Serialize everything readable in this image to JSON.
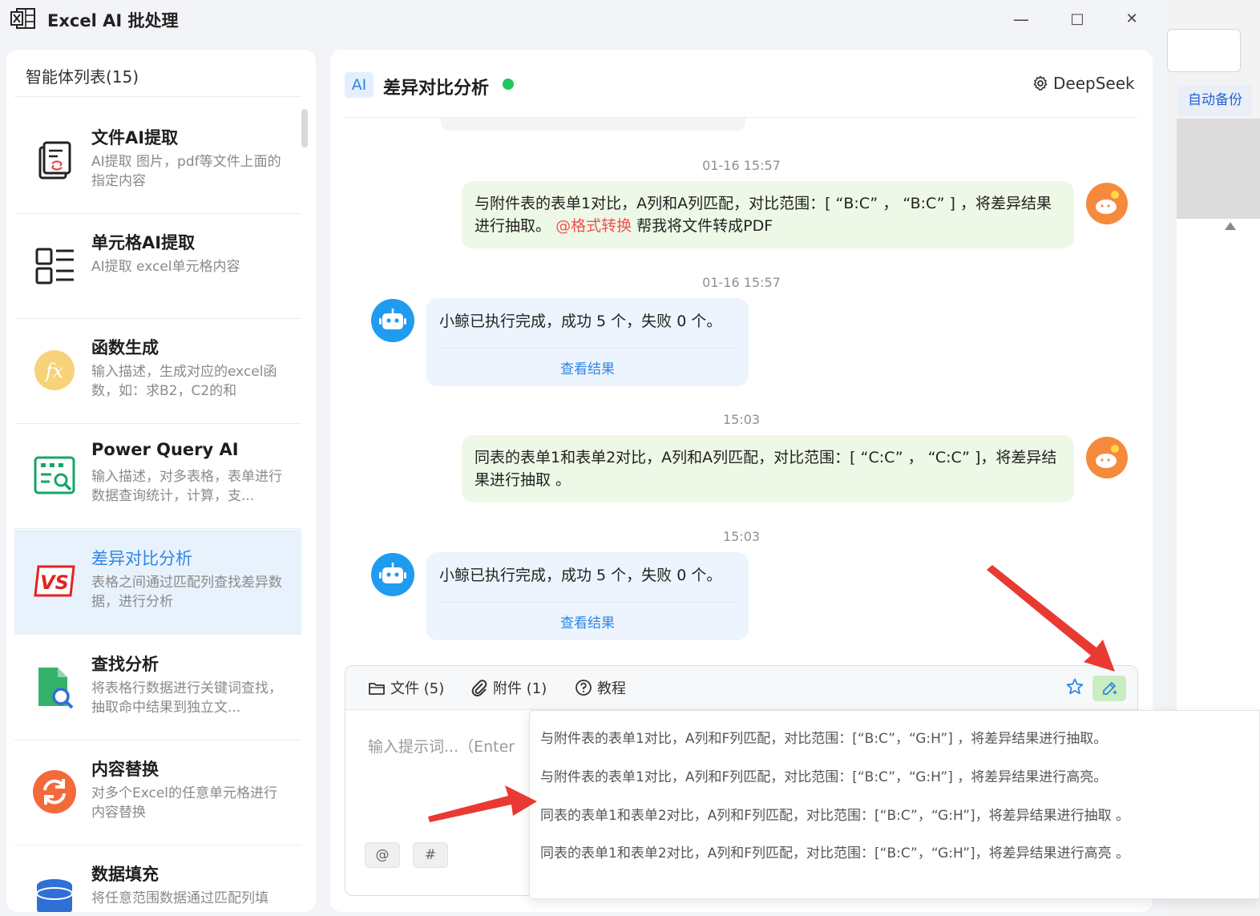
{
  "window": {
    "title": "Excel AI 批处理",
    "minimize": "—",
    "maximize": "□",
    "close": "✕"
  },
  "background_app": {
    "backup_label": "自动备份"
  },
  "sidebar": {
    "header": "智能体列表(15)",
    "items": [
      {
        "name": "文件AI提取",
        "desc": "AI提取 图片，pdf等文件上面的指定内容",
        "icon": "document-extract-icon"
      },
      {
        "name": "单元格AI提取",
        "desc": "AI提取 excel单元格内容",
        "icon": "cell-list-icon"
      },
      {
        "name": "函数生成",
        "desc": "输入描述，生成对应的excel函数，如：求B2，C2的和",
        "icon": "function-fx-icon"
      },
      {
        "name": "Power Query AI",
        "desc": "输入描述，对多表格，表单进行数据查询统计，计算，支...",
        "icon": "query-table-icon"
      },
      {
        "name": "差异对比分析",
        "desc": "表格之间通过匹配列查找差异数据，进行分析",
        "icon": "vs-icon"
      },
      {
        "name": "查找分析",
        "desc": "将表格行数据进行关键词查找，抽取命中结果到独立文...",
        "icon": "file-search-icon"
      },
      {
        "name": "内容替换",
        "desc": "对多个Excel的任意单元格进行内容替换",
        "icon": "replace-icon"
      },
      {
        "name": "数据填充",
        "desc": "将任意范围数据通过匹配列填",
        "icon": "database-icon"
      }
    ]
  },
  "chat": {
    "badge": "AI",
    "title": "差异对比分析",
    "model": "DeepSeek",
    "messages": [
      {
        "time": "01-16 15:57",
        "text": "与附件表的表单1对比，A列和A列匹配，对比范围：[ “B:C” ， “B:C” ] ，将差异结果进行抽取。",
        "mention": "@格式转换",
        "after": "帮我将文件转成PDF"
      },
      {
        "time": "01-16 15:57",
        "text": "小鲸已执行完成，成功 5 个，失败 0 个。",
        "link": "查看结果"
      },
      {
        "time": "15:03",
        "text": "同表的表单1和表单2对比，A列和A列匹配，对比范围：[ “C:C” ， “C:C” ]，将差异结果进行抽取 。"
      },
      {
        "time": "15:03",
        "text": "小鲸已执行完成，成功 5 个，失败 0 个。",
        "link": "查看结果"
      }
    ]
  },
  "input": {
    "files_label": "文件 (5)",
    "attach_label": "附件 (1)",
    "tutorial_label": "教程",
    "placeholder": "输入提示词...（Enter",
    "chip_at": "@",
    "chip_hash": "#"
  },
  "suggestions": [
    "与附件表的表单1对比，A列和F列匹配，对比范围：[“B:C”，“G:H”] ，将差异结果进行抽取。",
    "与附件表的表单1对比，A列和F列匹配，对比范围：[“B:C”，“G:H”] ，将差异结果进行高亮。",
    "同表的表单1和表单2对比，A列和F列匹配，对比范围：[“B:C”，“G:H”]，将差异结果进行抽取 。",
    "同表的表单1和表单2对比，A列和F列匹配，对比范围：[“B:C”，“G:H”]，将差异结果进行高亮 。"
  ],
  "colors": {
    "accent": "#2f86e6",
    "user_bubble": "#eef8e6",
    "bot_bubble": "#edf4fd",
    "mention": "#ef5350",
    "online": "#22c55e",
    "arrow": "#e83a33"
  }
}
